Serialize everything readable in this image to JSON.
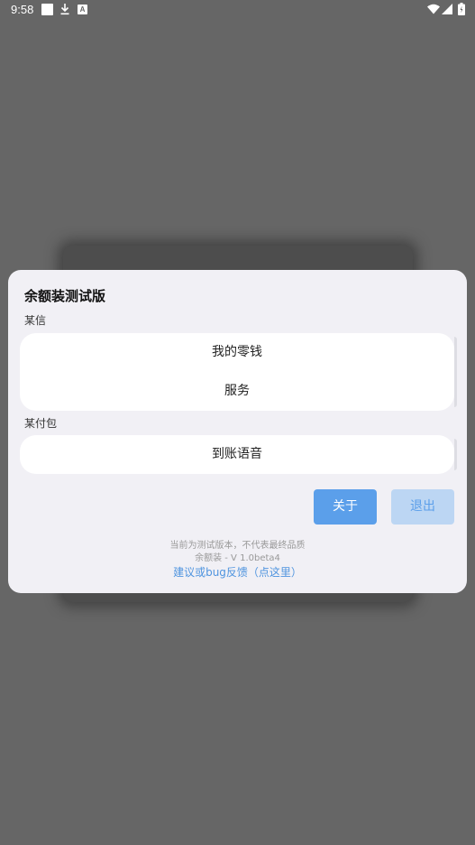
{
  "status_bar": {
    "time": "9:58",
    "notif_a_glyph": "A"
  },
  "dialog": {
    "title": "余额装测试版",
    "sections": [
      {
        "label": "某信",
        "items": [
          "我的零钱",
          "服务"
        ]
      },
      {
        "label": "某付包",
        "items": [
          "到账语音"
        ]
      }
    ],
    "buttons": {
      "about": "关于",
      "exit": "退出"
    },
    "footer": {
      "disclaimer": "当前为测试版本，不代表最终品质",
      "version": "余额装 - V 1.0beta4",
      "feedback_link": "建议或bug反馈（点这里）"
    }
  },
  "colors": {
    "accent": "#5b9fea",
    "accent_light": "#bcd6f3",
    "overlay": "#666666",
    "dialog_bg": "#f1f0f5"
  }
}
